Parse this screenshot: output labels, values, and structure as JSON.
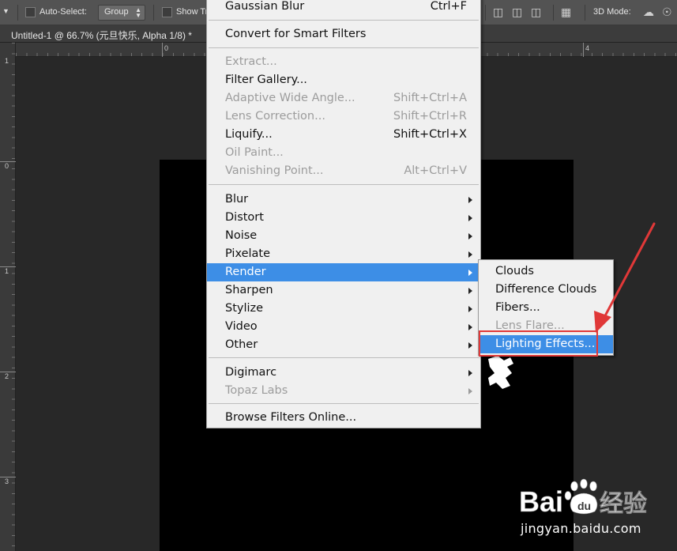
{
  "options_bar": {
    "auto_select_label": "Auto-Select:",
    "group_value": "Group",
    "show_label": "Show Tr",
    "three_d_mode_label": "3D Mode:"
  },
  "document_tab": {
    "title": "Untitled-1 @ 66.7% (元旦快乐, Alpha 1/8) *"
  },
  "rulers": {
    "top_numbers": [
      "0",
      "4"
    ],
    "left_numbers": [
      "1",
      "0",
      "1",
      "2",
      "3"
    ]
  },
  "filter_menu": {
    "items": [
      {
        "label": "Gaussian Blur",
        "shortcut": "Ctrl+F",
        "enabled": true
      },
      {
        "label": "Convert for Smart Filters",
        "shortcut": "",
        "enabled": true
      },
      {
        "label": "Extract...",
        "shortcut": "",
        "enabled": false
      },
      {
        "label": "Filter Gallery...",
        "shortcut": "",
        "enabled": true
      },
      {
        "label": "Adaptive Wide Angle...",
        "shortcut": "Shift+Ctrl+A",
        "enabled": false
      },
      {
        "label": "Lens Correction...",
        "shortcut": "Shift+Ctrl+R",
        "enabled": false
      },
      {
        "label": "Liquify...",
        "shortcut": "Shift+Ctrl+X",
        "enabled": true
      },
      {
        "label": "Oil Paint...",
        "shortcut": "",
        "enabled": false
      },
      {
        "label": "Vanishing Point...",
        "shortcut": "Alt+Ctrl+V",
        "enabled": false
      },
      {
        "label": "Blur",
        "shortcut": "",
        "enabled": true
      },
      {
        "label": "Distort",
        "shortcut": "",
        "enabled": true
      },
      {
        "label": "Noise",
        "shortcut": "",
        "enabled": true
      },
      {
        "label": "Pixelate",
        "shortcut": "",
        "enabled": true
      },
      {
        "label": "Render",
        "shortcut": "",
        "enabled": true
      },
      {
        "label": "Sharpen",
        "shortcut": "",
        "enabled": true
      },
      {
        "label": "Stylize",
        "shortcut": "",
        "enabled": true
      },
      {
        "label": "Video",
        "shortcut": "",
        "enabled": true
      },
      {
        "label": "Other",
        "shortcut": "",
        "enabled": true
      },
      {
        "label": "Digimarc",
        "shortcut": "",
        "enabled": true
      },
      {
        "label": "Topaz Labs",
        "shortcut": "",
        "enabled": false
      },
      {
        "label": "Browse Filters Online...",
        "shortcut": "",
        "enabled": true
      }
    ]
  },
  "render_submenu": {
    "items": [
      {
        "label": "Clouds",
        "enabled": true
      },
      {
        "label": "Difference Clouds",
        "enabled": true
      },
      {
        "label": "Fibers...",
        "enabled": true
      },
      {
        "label": "Lens Flare...",
        "enabled": false
      },
      {
        "label": "Lighting Effects...",
        "enabled": true
      }
    ]
  },
  "watermark": {
    "brand": "Bai du 经验",
    "url": "jingyan.baidu.com"
  },
  "colors": {
    "menu_highlight": "#3d8ee6",
    "callout_red": "#e03838",
    "menu_background": "#f0f0f0",
    "workspace": "#282828"
  }
}
